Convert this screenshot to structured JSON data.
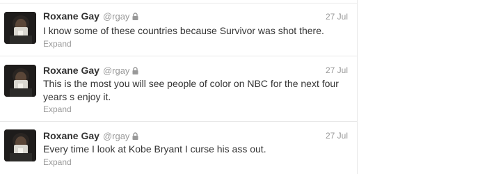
{
  "tweets": [
    {
      "name": "Roxane Gay",
      "handle": "@rgay",
      "time": "27 Jul",
      "text": "I know some of these countries because Survivor was shot there.",
      "expand": "Expand",
      "protected_icon": "lock-icon",
      "avatar": "avatar-icon"
    },
    {
      "name": "Roxane Gay",
      "handle": "@rgay",
      "time": "27 Jul",
      "text": "This is the most you will see people of color on NBC for the next four years s enjoy it.",
      "expand": "Expand",
      "protected_icon": "lock-icon",
      "avatar": "avatar-icon"
    },
    {
      "name": "Roxane Gay",
      "handle": "@rgay",
      "time": "27 Jul",
      "text": "Every time I look at Kobe Bryant I curse his ass out.",
      "expand": "Expand",
      "protected_icon": "lock-icon",
      "avatar": "avatar-icon"
    }
  ]
}
